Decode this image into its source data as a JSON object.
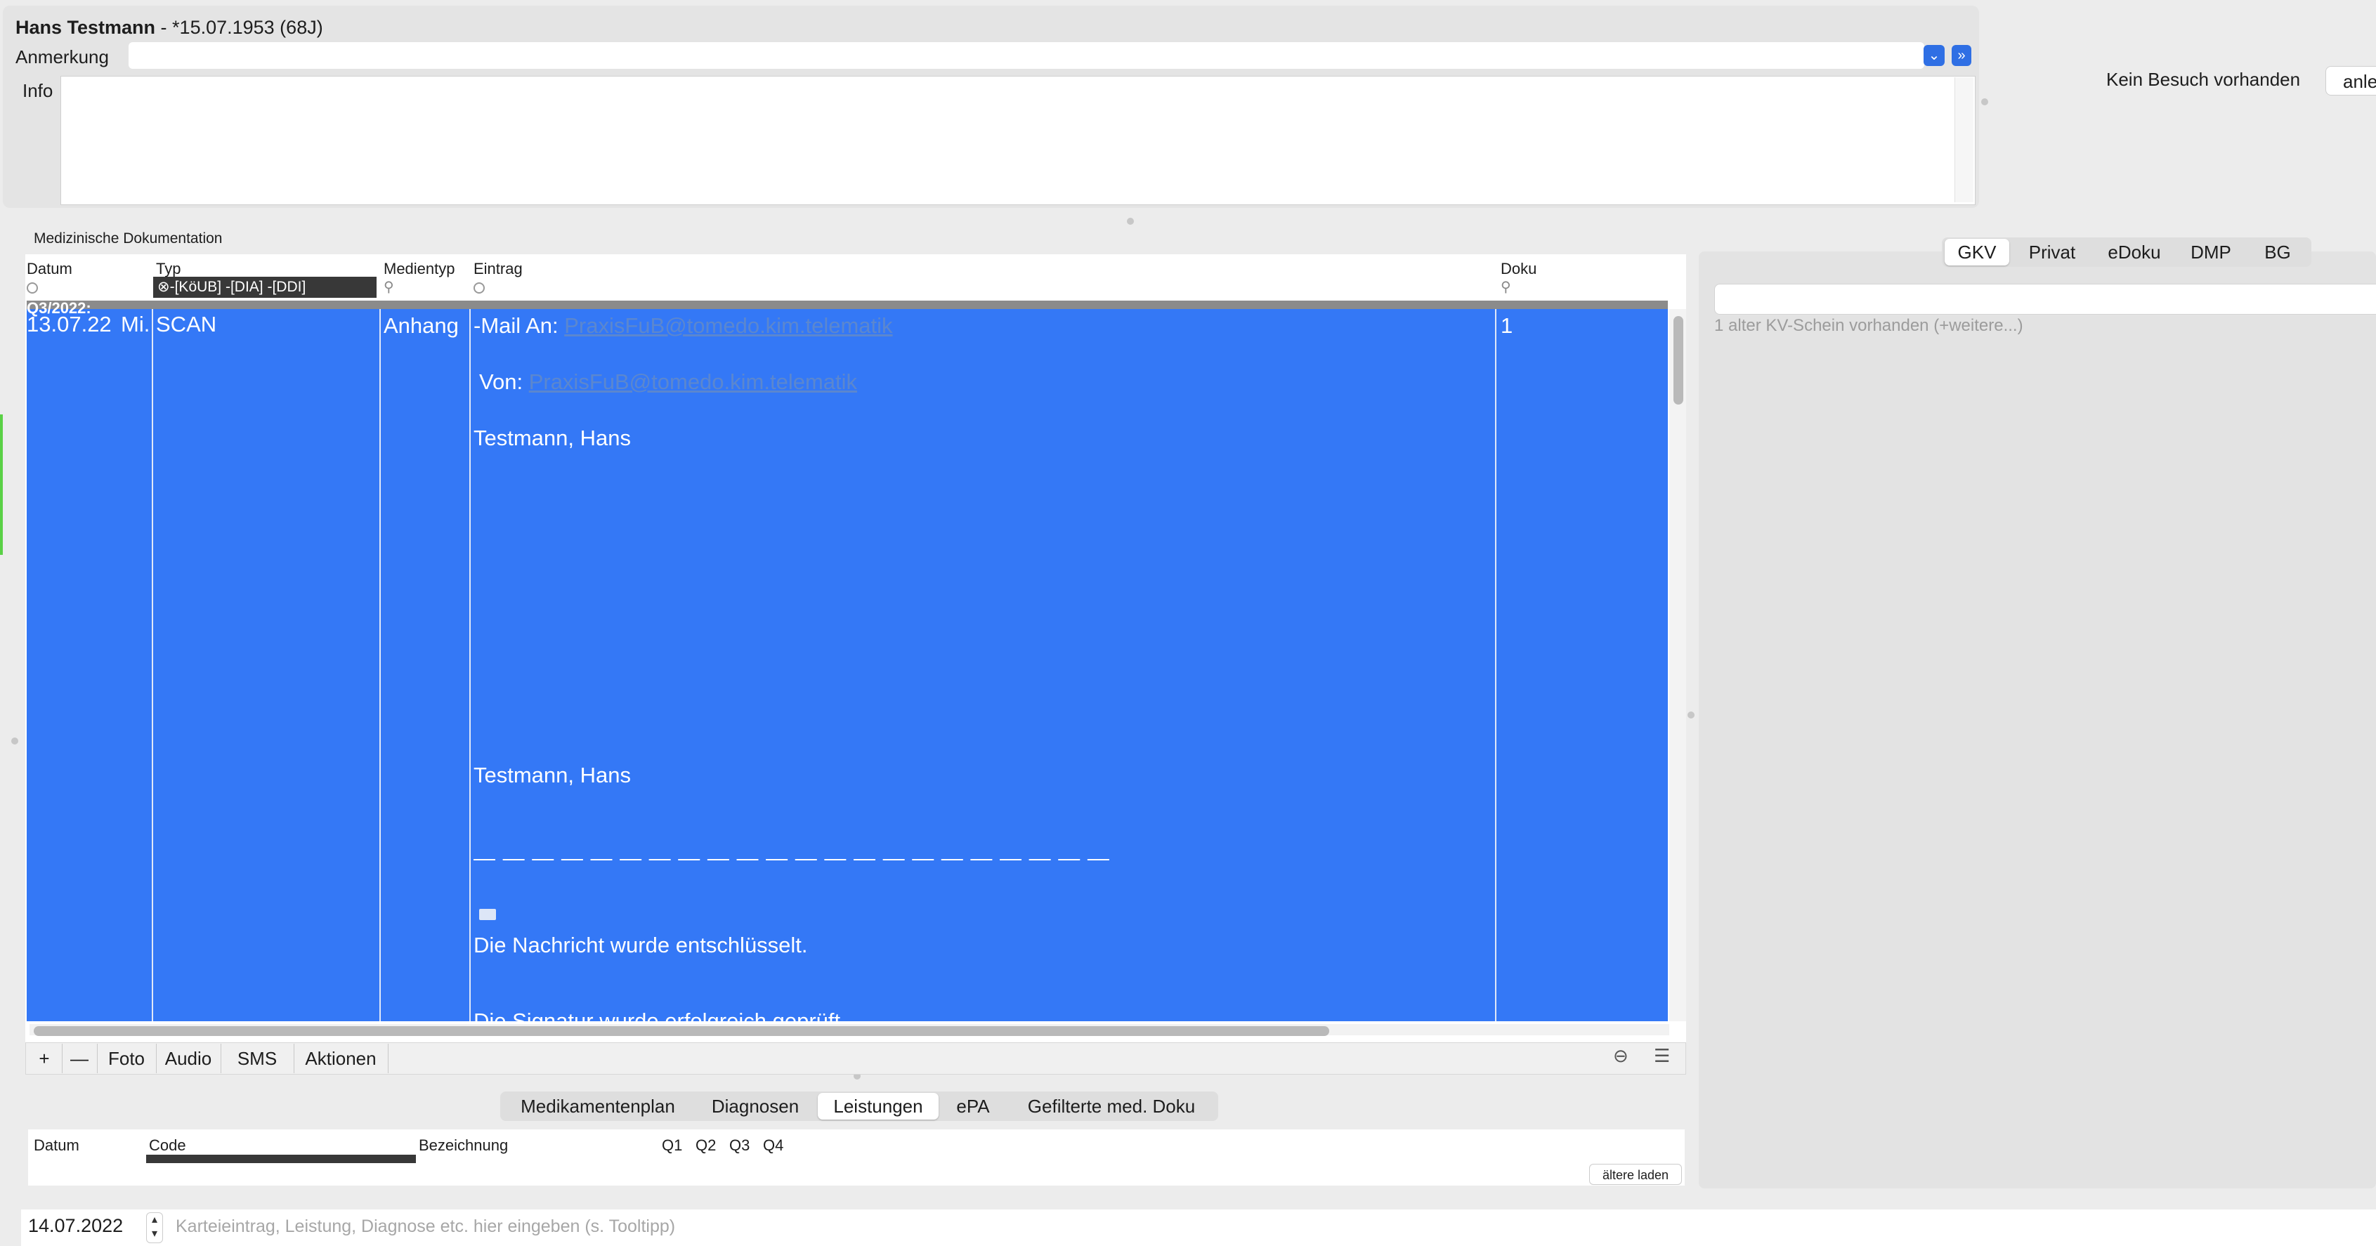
{
  "patient": {
    "name": "Hans Testmann",
    "birth": " - *15.07.1953 (68J)"
  },
  "header": {
    "anmerkung_label": "Anmerkung",
    "info_label": "Info",
    "visit_status": "Kein Besuch vorhanden",
    "visit_button": "anle"
  },
  "section_title": "Medizinische Dokumentation",
  "table": {
    "columns": [
      "Datum",
      "Typ",
      "Medientyp",
      "Eintrag",
      "Doku"
    ],
    "typ_filter": "-[KöUB] -[DIA] -[DDI]",
    "quarter_label": "Q3/2022:",
    "row": {
      "date": "13.07.22",
      "weekday": "Mi.",
      "typ": "SCAN",
      "medientyp": "Anhang",
      "mail_prefix": "-Mail An: ",
      "mail_to": "PraxisFuB@tomedo.kim.telematik",
      "von_prefix": "Von: ",
      "mail_from": "PraxisFuB@tomedo.kim.telematik",
      "name1": "Testmann, Hans",
      "name2": "Testmann, Hans",
      "divider": "— — — — — — — — — — — — — — — — — — — — — —",
      "message": "Die Nachricht wurde entschlüsselt.",
      "cut_text": "Die Signatur wurde erfolgreich geprüft",
      "doku": "1"
    }
  },
  "toolbar": {
    "add": "+",
    "remove": "—",
    "foto": "Foto",
    "audio": "Audio",
    "sms": "SMS",
    "aktionen": "Aktionen"
  },
  "tabs": [
    "Medikamentenplan",
    "Diagnosen",
    "Leistungen",
    "ePA",
    "Gefilterte med. Doku"
  ],
  "tabs_selected": "Leistungen",
  "lower_table": {
    "columns": [
      "Datum",
      "Code",
      "Bezeichnung",
      "Q1",
      "Q2",
      "Q3",
      "Q4"
    ],
    "older_button": "ältere laden"
  },
  "entry": {
    "date": "14.07.2022",
    "placeholder": "Karteieintrag, Leistung, Diagnose etc. hier eingeben (s. Tooltipp)"
  },
  "right_tabs": [
    "GKV",
    "Privat",
    "eDoku",
    "DMP",
    "BG"
  ],
  "right_tabs_selected": "GKV",
  "kv_info": "1 alter KV-Schein vorhanden (+weitere...)",
  "colors": {
    "selection": "#3478f6",
    "accent": "#2f6fe4",
    "link": "#5b87cf"
  }
}
